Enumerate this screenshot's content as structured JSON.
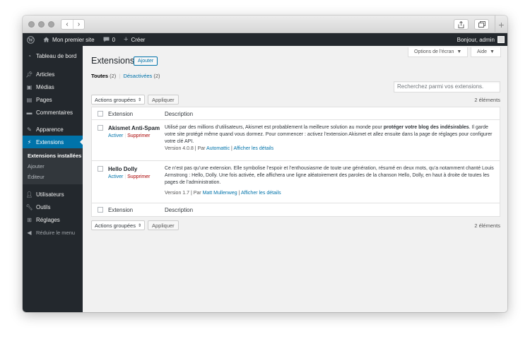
{
  "browser": {
    "back": "‹",
    "forward": "›",
    "share_icon": "share-icon",
    "tabs_icon": "tabs-icon",
    "new_tab": "+"
  },
  "adminbar": {
    "site": "Mon premier site",
    "comments": "0",
    "create": "Créer",
    "greeting": "Bonjour, admin"
  },
  "sidebar": {
    "dashboard": "Tableau de bord",
    "items": [
      {
        "label": "Articles",
        "icon": "pin-icon"
      },
      {
        "label": "Médias",
        "icon": "media-icon"
      },
      {
        "label": "Pages",
        "icon": "page-icon"
      },
      {
        "label": "Commentaires",
        "icon": "comment-icon"
      }
    ],
    "appearance": "Apparence",
    "extensions": "Extensions",
    "sub": [
      "Extensions installées",
      "Ajouter",
      "Éditeur"
    ],
    "users": "Utilisateurs",
    "tools": "Outils",
    "settings": "Réglages",
    "collapse": "Réduire le menu"
  },
  "main": {
    "screen_options": "Options de l’écran",
    "help": "Aide",
    "title": "Extensions",
    "add_new": "Ajouter",
    "filter_all": "Toutes",
    "filter_all_count": "(2)",
    "filter_sep": "|",
    "filter_inactive": "Désactivées",
    "filter_inactive_count": "(2)",
    "search_placeholder": "Recherchez parmi vos extensions.",
    "bulk_label": "Actions groupées",
    "apply": "Appliquer",
    "items_count": "2 éléments",
    "col_extension": "Extension",
    "col_description": "Description",
    "plugins": [
      {
        "name": "Akismet Anti-Spam",
        "activate": "Activer",
        "sep": "|",
        "delete": "Supprimer",
        "desc_a": "Utilisé par des millions d’utilisateurs, Akismet est probablement la meilleure solution au monde pour ",
        "desc_b": "protéger votre blog des indésirables",
        "desc_c": ". Il garde votre site protégé même quand vous dormez. Pour commencer : activez l’extension Akismet et allez ensuite dans la page de réglages pour configurer votre clé API.",
        "version": "Version 4.0.8 | Par ",
        "author": "Automattic",
        "meta_sep": " | ",
        "details": "Afficher les détails"
      },
      {
        "name": "Hello Dolly",
        "activate": "Activer",
        "sep": "|",
        "delete": "Supprimer",
        "desc_a": "Ce n’est pas qu’une extension. Elle symbolise l’espoir et l’enthousiasme de toute une génération, résumé en deux mots, qu’a notamment chanté Louis Armstrong : Hello, Dolly. Une fois activée, elle affichera une ligne aléatoirement des paroles de la chanson Hello, Dolly, en haut à droite de toutes les pages de l’administration.",
        "version": "Version 1.7 | Par ",
        "author": "Matt Mullenweg",
        "meta_sep": " | ",
        "details": "Afficher les détails"
      }
    ]
  }
}
